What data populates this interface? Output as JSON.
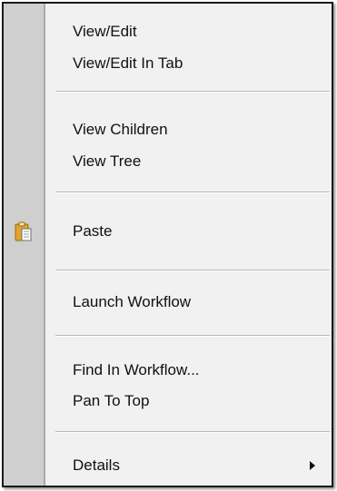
{
  "menu": {
    "items": [
      {
        "label": "View/Edit"
      },
      {
        "label": "View/Edit In Tab"
      },
      {
        "label": "View Children"
      },
      {
        "label": "View Tree"
      },
      {
        "label": "Paste",
        "icon": "clipboard-icon"
      },
      {
        "label": "Launch Workflow"
      },
      {
        "label": "Find In Workflow..."
      },
      {
        "label": "Pan To Top"
      },
      {
        "label": "Details",
        "has_submenu": true
      }
    ]
  },
  "colors": {
    "gutter": "#cfcfcf",
    "menu_background": "#f1f1f1",
    "border": "#1a1a1a",
    "separator": "#b9b9b9",
    "text": "#111111",
    "icon_gold": "#e0a533"
  }
}
